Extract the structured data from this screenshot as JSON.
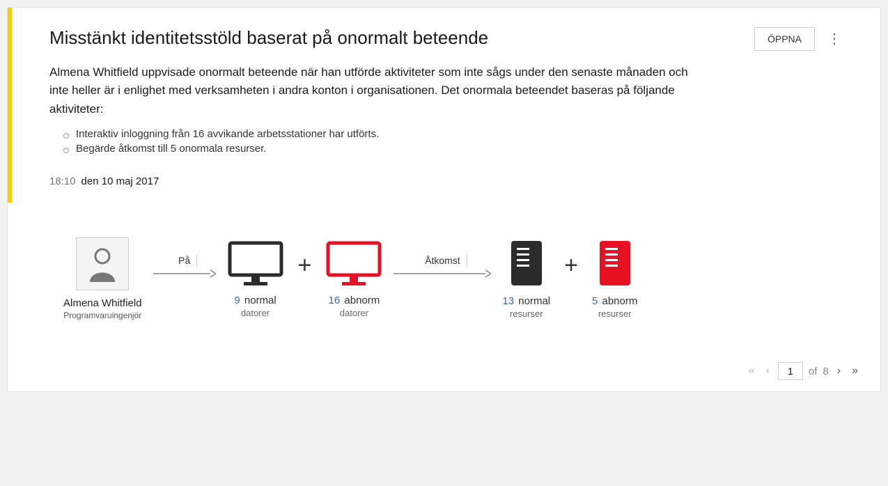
{
  "alert": {
    "title": "Misstänkt identitetsstöld baserat på onormalt beteende",
    "open_label": "ÖPPNA",
    "description": "Almena Whitfield uppvisade onormalt beteende när han utförde aktiviteter som inte sågs under den senaste månaden och inte heller är i enlighet med verksamheten i andra konton i organisationen. Det onormala beteendet baseras på följande aktiviteter:",
    "bullets": [
      "Interaktiv inloggning från 16 avvikande arbetsstationer har utförts.",
      "Begärde åtkomst till 5 onormala resurser."
    ],
    "time": "18:10",
    "date": "den 10 maj 2017"
  },
  "actor": {
    "name": "Almena Whitfield",
    "role": "Programvaruingenjör"
  },
  "flow": {
    "arrow_on": "På",
    "arrow_access": "Åtkomst"
  },
  "computers": {
    "normal": {
      "count": "9",
      "status": "normal",
      "type": "datorer"
    },
    "abnormal": {
      "count": "16",
      "status": "abnorm",
      "type": "datorer"
    }
  },
  "resources": {
    "normal": {
      "count": "13",
      "status": "normal",
      "type": "resurser"
    },
    "abnormal": {
      "count": "5",
      "status": "abnorm",
      "type": "resurser"
    }
  },
  "pagination": {
    "current": "1",
    "of_label": "of",
    "total": "8"
  },
  "colors": {
    "accent": "#ffcc00",
    "danger": "#e81123",
    "link": "#3366cc"
  }
}
